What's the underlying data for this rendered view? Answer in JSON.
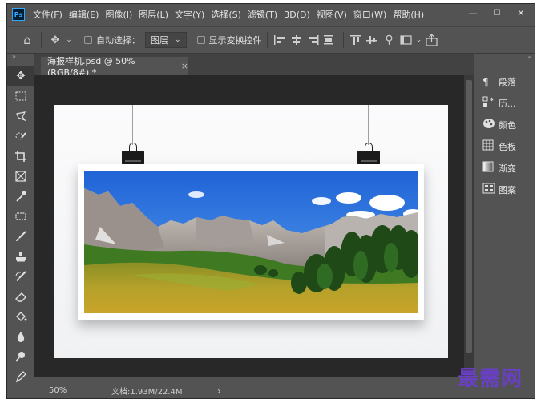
{
  "app": {
    "logo": "Ps"
  },
  "menu": [
    "文件(F)",
    "编辑(E)",
    "图像(I)",
    "图层(L)",
    "文字(Y)",
    "选择(S)",
    "滤镜(T)",
    "3D(D)",
    "视图(V)",
    "窗口(W)",
    "帮助(H)"
  ],
  "window_controls": {
    "minimize": "—",
    "maximize": "☐",
    "close": "✕"
  },
  "options": {
    "auto_select_label": "自动选择：",
    "auto_select_value": "图层",
    "show_transform_label": "显示变换控件"
  },
  "document": {
    "tab_title": "海报样机.psd @ 50%(RGB/8#) *",
    "tab_close": "×"
  },
  "status": {
    "zoom": "50%",
    "doc_size": "文档:1.93M/22.4M",
    "arrow": "›"
  },
  "right_panels": [
    {
      "icon": "paragraph-icon",
      "label": "段落"
    },
    {
      "icon": "history-icon",
      "label": "历..."
    },
    {
      "icon": "color-icon",
      "label": "颜色"
    },
    {
      "icon": "swatches-icon",
      "label": "色板"
    },
    {
      "icon": "gradient-icon",
      "label": "渐变"
    },
    {
      "icon": "patterns-icon",
      "label": "图案"
    }
  ],
  "panel_toggles": {
    "left": "»",
    "right": "«"
  },
  "watermark": "最需网",
  "colors": {
    "ui_bg": "#535353",
    "pasteboard": "#282828",
    "sky": "#3b82f6",
    "grass": "#b7a528",
    "accent": "#31a8ff"
  }
}
